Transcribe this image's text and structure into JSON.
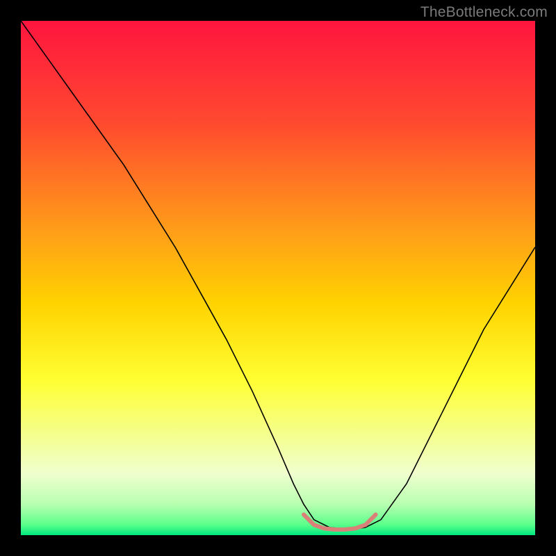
{
  "watermark": "TheBottleneck.com",
  "chart_data": {
    "type": "line",
    "title": "",
    "xlabel": "",
    "ylabel": "",
    "xlim": [
      0,
      100
    ],
    "ylim": [
      0,
      100
    ],
    "grid": false,
    "legend": false,
    "background_gradient": {
      "stops": [
        {
          "offset": 0.0,
          "color": "#ff153f"
        },
        {
          "offset": 0.2,
          "color": "#ff4a2f"
        },
        {
          "offset": 0.4,
          "color": "#ff9a1a"
        },
        {
          "offset": 0.55,
          "color": "#ffd300"
        },
        {
          "offset": 0.7,
          "color": "#ffff33"
        },
        {
          "offset": 0.8,
          "color": "#f5ff8a"
        },
        {
          "offset": 0.88,
          "color": "#f0ffce"
        },
        {
          "offset": 0.94,
          "color": "#b8ffb0"
        },
        {
          "offset": 0.98,
          "color": "#5aff8a"
        },
        {
          "offset": 1.0,
          "color": "#00e880"
        }
      ]
    },
    "series": [
      {
        "name": "bottleneck-curve",
        "color": "#000000",
        "stroke_width": 1.6,
        "x": [
          0,
          5,
          10,
          15,
          20,
          25,
          30,
          35,
          40,
          45,
          50,
          53,
          55,
          57,
          60,
          63,
          65,
          67,
          70,
          75,
          80,
          85,
          90,
          95,
          100
        ],
        "y": [
          100,
          93,
          86,
          79,
          72,
          64,
          56,
          47,
          38,
          28,
          17,
          10,
          6,
          3,
          1.5,
          1.2,
          1.2,
          1.5,
          3,
          10,
          20,
          30,
          40,
          48,
          56
        ]
      },
      {
        "name": "optimal-band",
        "color": "#d98079",
        "stroke_width": 6,
        "linecap": "round",
        "x": [
          55,
          57,
          59,
          61,
          63,
          65,
          67,
          69
        ],
        "y": [
          4,
          2,
          1.3,
          1.1,
          1.1,
          1.3,
          2,
          4
        ]
      }
    ]
  }
}
